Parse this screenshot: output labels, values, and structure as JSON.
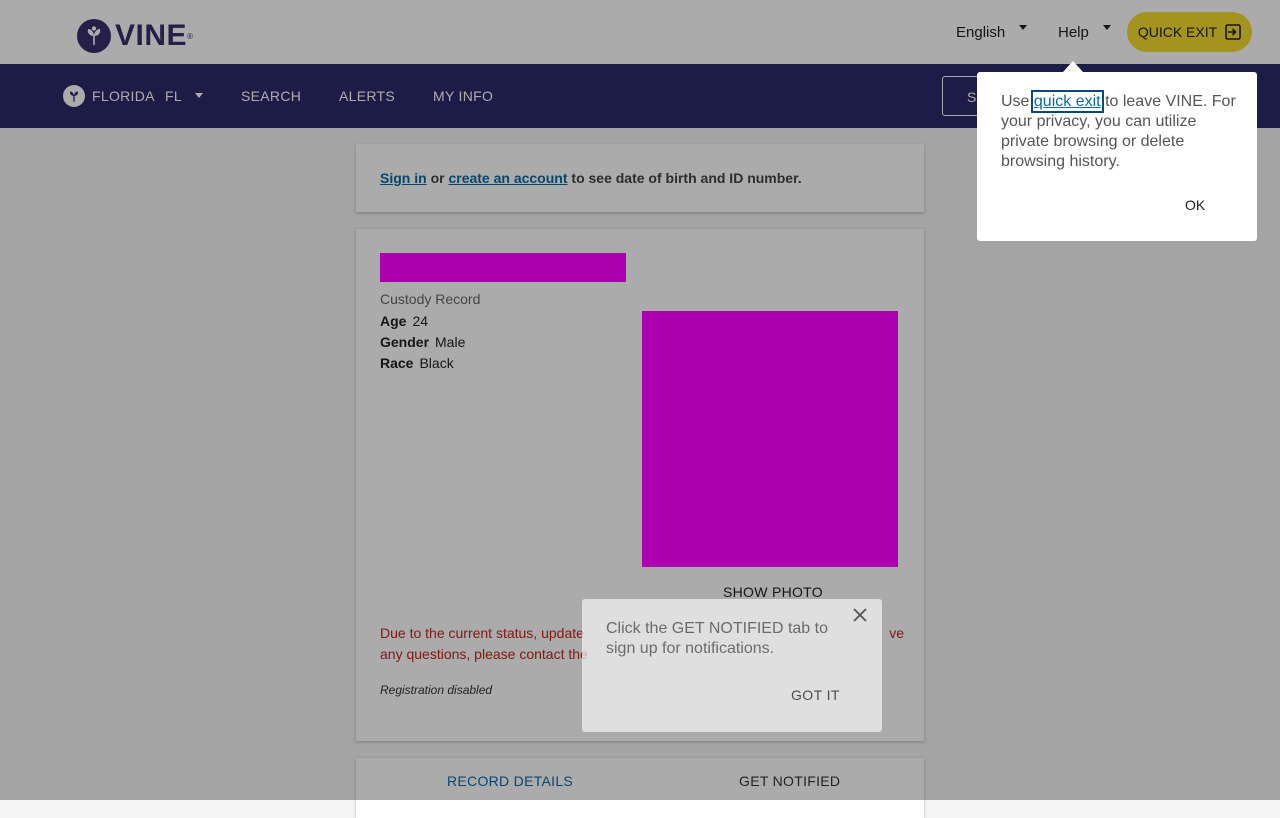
{
  "header": {
    "logo_text": "VINE",
    "logo_reg": "®",
    "language": "English",
    "help": "Help",
    "quick_exit": "QUICK EXIT"
  },
  "nav": {
    "state_name": "FLORIDA",
    "state_code": "FL",
    "items": [
      "SEARCH",
      "ALERTS",
      "MY INFO"
    ],
    "button_fragment": "S"
  },
  "signin_card": {
    "sign_in": "Sign in",
    "or": "or",
    "create_account": "create an account",
    "suffix": "to see date of birth and ID number."
  },
  "record": {
    "type": "Custody Record",
    "attributes": [
      {
        "label": "Age",
        "value": "24"
      },
      {
        "label": "Gender",
        "value": "Male"
      },
      {
        "label": "Race",
        "value": "Black"
      }
    ],
    "show_photo": "SHOW PHOTO",
    "status_line1_left": "Due to the current status, update",
    "status_line1_right": "ve",
    "status_line2": "any questions, please contact the",
    "registration": "Registration disabled"
  },
  "tabs": [
    "RECORD DETAILS",
    "GET NOTIFIED"
  ],
  "quick_exit_popup": {
    "prefix": "Use",
    "link": "quick exit",
    "suffix": "to leave VINE. For your privacy, you can utilize private browsing or delete browsing history.",
    "ok": "OK"
  },
  "notify_popup": {
    "text": "Click the GET NOTIFIED tab to sign up for notifications.",
    "got_it": "GOT IT"
  },
  "colors": {
    "nav": "#2c2b6b",
    "accent_yellow": "#f5dc2e",
    "link": "#0a6aa6",
    "warning": "#c0281e",
    "redaction": "#ff00ff"
  }
}
